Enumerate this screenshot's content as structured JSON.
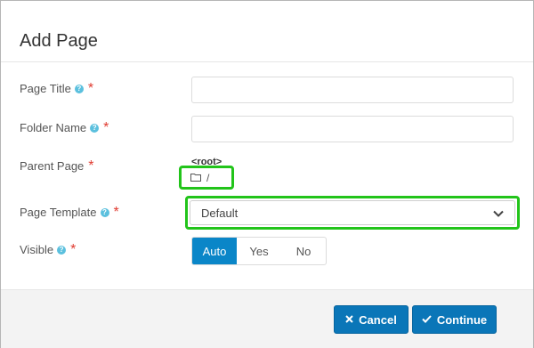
{
  "dialog": {
    "title": "Add Page"
  },
  "form": {
    "page_title": {
      "label": "Page Title",
      "value": "",
      "placeholder": ""
    },
    "folder_name": {
      "label": "Folder Name",
      "value": "",
      "placeholder": ""
    },
    "parent_page": {
      "label": "Parent Page",
      "root_label": "<root>",
      "folder_path": "/"
    },
    "page_template": {
      "label": "Page Template",
      "selected": "Default"
    },
    "visible": {
      "label": "Visible",
      "options": [
        "Auto",
        "Yes",
        "No"
      ],
      "selected": "Auto"
    },
    "help_glyph": "?",
    "required_glyph": "*"
  },
  "footer": {
    "cancel_label": "Cancel",
    "continue_label": "Continue"
  },
  "colors": {
    "accent": "#0a86c8",
    "button": "#0a76b8",
    "highlight": "#22c41a",
    "required": "#e03c31",
    "help": "#5bc0de"
  },
  "icons": {
    "help": "question-circle-icon",
    "folder": "folder-icon",
    "chevron": "chevron-down-icon",
    "cancel": "times-icon",
    "continue": "check-icon"
  }
}
